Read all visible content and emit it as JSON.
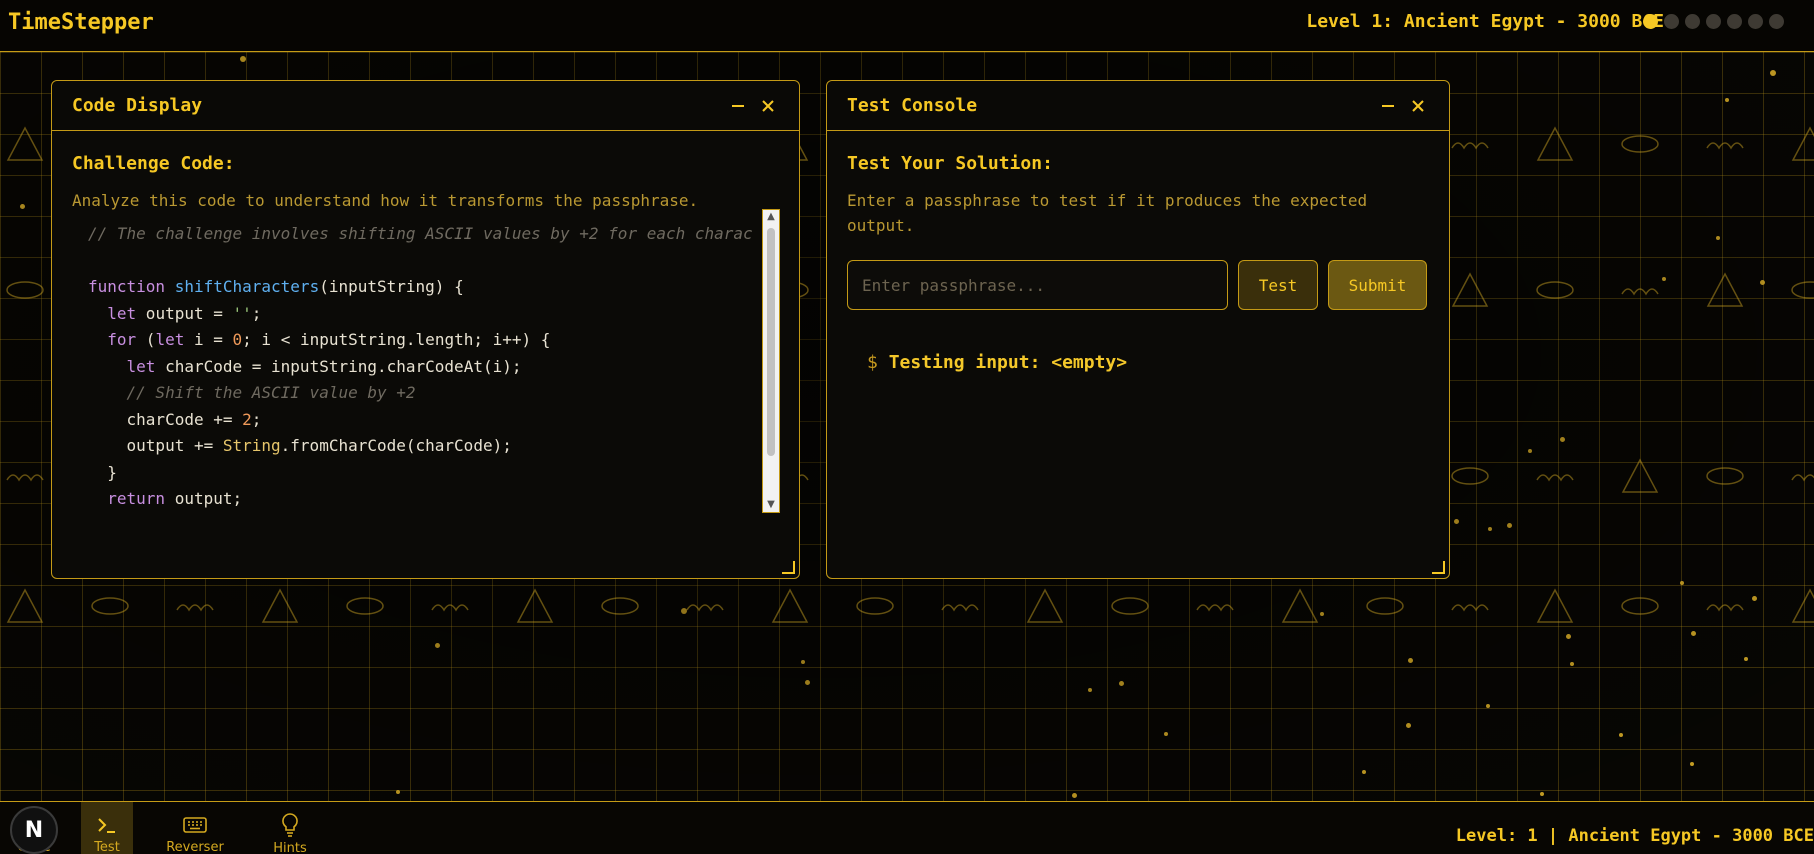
{
  "header": {
    "app_title": "TimeStepper",
    "level_title": "Level 1: Ancient Egypt - 3000 BCE",
    "progress": {
      "current": 1,
      "total": 7
    }
  },
  "code_window": {
    "title": "Code Display",
    "section_title": "Challenge Code:",
    "description": "Analyze this code to understand how it transforms the passphrase.",
    "code_lines": [
      [
        {
          "t": "// The challenge involves shifting ASCII values by +2 for each charac",
          "c": "comment"
        }
      ],
      [],
      [
        {
          "t": "function ",
          "c": "kw"
        },
        {
          "t": "shiftCharacters",
          "c": "fn"
        },
        {
          "t": "(inputString) {",
          "c": ""
        }
      ],
      [
        {
          "t": "  ",
          "c": ""
        },
        {
          "t": "let",
          "c": "kw"
        },
        {
          "t": " output = ",
          "c": ""
        },
        {
          "t": "''",
          "c": "str"
        },
        {
          "t": ";",
          "c": ""
        }
      ],
      [
        {
          "t": "  ",
          "c": ""
        },
        {
          "t": "for",
          "c": "kw"
        },
        {
          "t": " (",
          "c": ""
        },
        {
          "t": "let",
          "c": "kw"
        },
        {
          "t": " i = ",
          "c": ""
        },
        {
          "t": "0",
          "c": "num"
        },
        {
          "t": "; i < inputString.length; i++) {",
          "c": ""
        }
      ],
      [
        {
          "t": "    ",
          "c": ""
        },
        {
          "t": "let",
          "c": "kw"
        },
        {
          "t": " charCode = inputString.charCodeAt(i);",
          "c": ""
        }
      ],
      [
        {
          "t": "    ",
          "c": ""
        },
        {
          "t": "// Shift the ASCII value by +2",
          "c": "comment"
        }
      ],
      [
        {
          "t": "    charCode += ",
          "c": ""
        },
        {
          "t": "2",
          "c": "num"
        },
        {
          "t": ";",
          "c": ""
        }
      ],
      [
        {
          "t": "    output += ",
          "c": ""
        },
        {
          "t": "String",
          "c": "cls"
        },
        {
          "t": ".fromCharCode(charCode);",
          "c": ""
        }
      ],
      [
        {
          "t": "  }",
          "c": ""
        }
      ],
      [
        {
          "t": "  ",
          "c": ""
        },
        {
          "t": "return",
          "c": "kw"
        },
        {
          "t": " output;",
          "c": ""
        }
      ]
    ]
  },
  "console_window": {
    "title": "Test Console",
    "section_title": "Test Your Solution:",
    "description": "Enter a passphrase to test if it produces the expected output.",
    "input_placeholder": "Enter passphrase...",
    "input_value": "",
    "test_label": "Test",
    "submit_label": "Submit",
    "output_prompt": "$",
    "output_text": "Testing input: <empty>"
  },
  "bottom_nav": {
    "badge": "N",
    "tabs": [
      {
        "label": "Code",
        "icon": "code-icon",
        "active": false
      },
      {
        "label": "Test",
        "icon": "terminal-icon",
        "active": true
      },
      {
        "label": "Reverser",
        "icon": "keyboard-icon",
        "active": false
      },
      {
        "label": "Hints",
        "icon": "lightbulb-icon",
        "active": false
      }
    ],
    "status_text": "Level: 1 | Ancient Egypt - 3000 BCE"
  },
  "colors": {
    "accent": "#f6c824",
    "border": "#c49a16",
    "background": "#070603"
  }
}
